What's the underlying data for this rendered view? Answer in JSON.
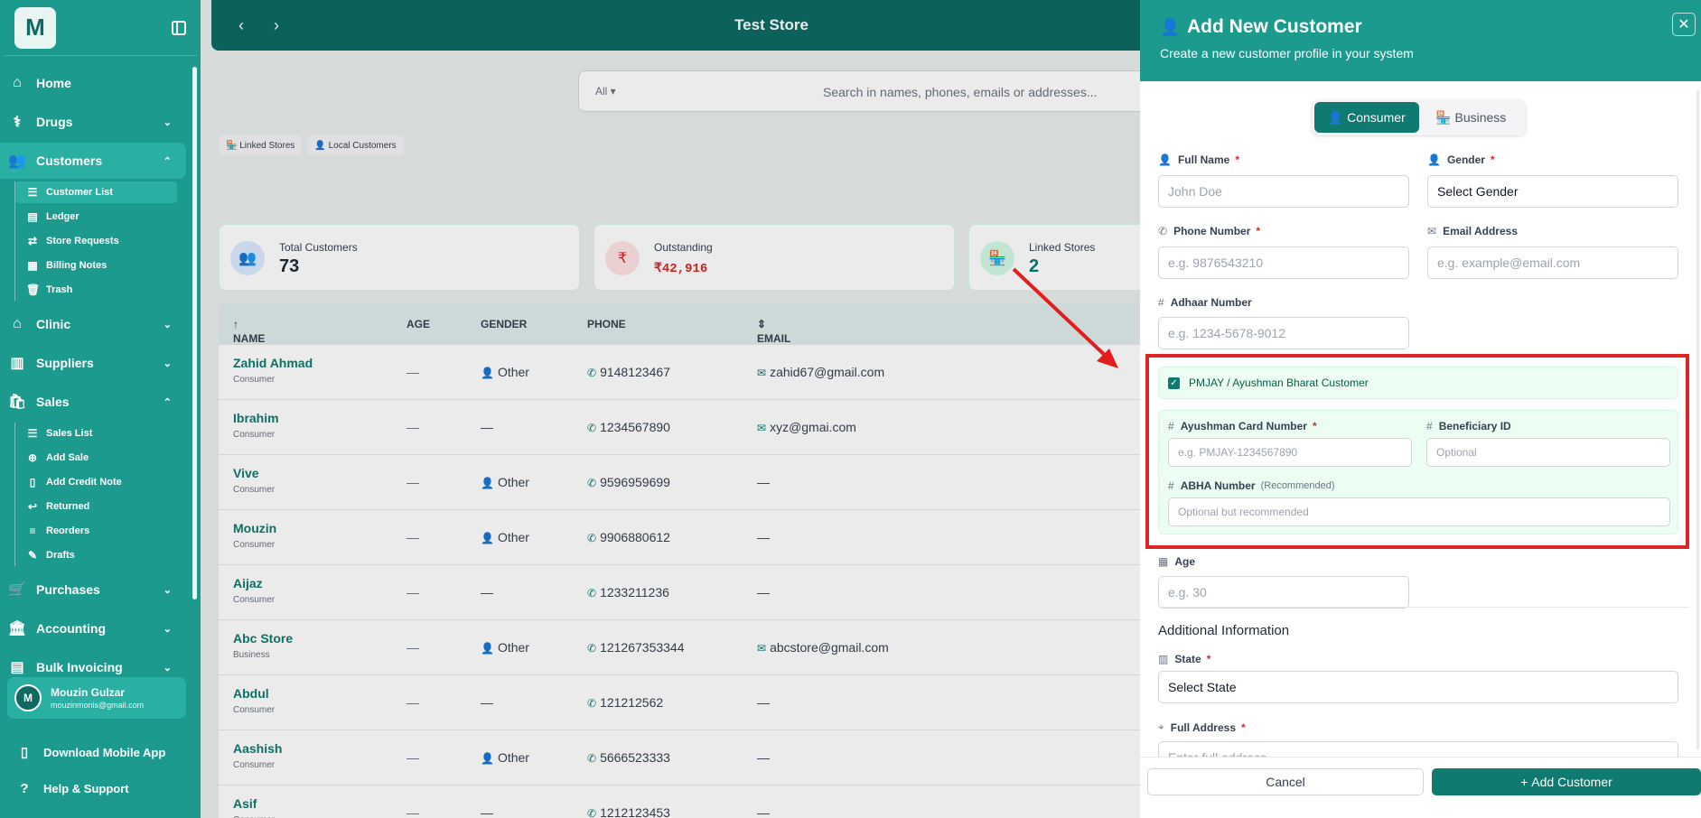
{
  "sidebar": {
    "logo": "M",
    "items": {
      "home": "Home",
      "drugs": "Drugs",
      "customers": "Customers",
      "clinic": "Clinic",
      "suppliers": "Suppliers",
      "sales": "Sales",
      "purchases": "Purchases",
      "accounting": "Accounting",
      "bulk": "Bulk Invoicing"
    },
    "customers_sub": [
      "Customer List",
      "Ledger",
      "Store Requests",
      "Billing Notes",
      "Trash"
    ],
    "sales_sub": [
      "Sales List",
      "Add Sale",
      "Add Credit Note",
      "Returned",
      "Reorders",
      "Drafts"
    ],
    "user": {
      "initial": "M",
      "name": "Mouzin Gulzar",
      "email": "mouzinmonis@gmail.com"
    },
    "download": "Download Mobile App",
    "help": "Help & Support"
  },
  "main": {
    "store_title": "Test Store",
    "search": {
      "filter": "All",
      "placeholder": "Search in names, phones, emails or addresses..."
    },
    "chips": [
      "Linked Stores",
      "Local Customers"
    ],
    "stats": [
      {
        "label": "Total Customers",
        "value": "73"
      },
      {
        "label": "Outstanding",
        "value": "₹42,916"
      },
      {
        "label": "Linked Stores",
        "value": "2"
      }
    ],
    "table": {
      "headers": {
        "name": "NAME",
        "age": "AGE",
        "gender": "GENDER",
        "phone": "PHONE",
        "email": "EMAIL"
      },
      "rows": [
        {
          "name": "Zahid Ahmad",
          "type": "Consumer",
          "age": "—",
          "gender": "Other",
          "phone": "9148123467",
          "email": "zahid67@gmail.com"
        },
        {
          "name": "Ibrahim",
          "type": "Consumer",
          "age": "—",
          "gender": "—",
          "phone": "1234567890",
          "email": "xyz@gmai.com"
        },
        {
          "name": "Vive",
          "type": "Consumer",
          "age": "—",
          "gender": "Other",
          "phone": "9596959699",
          "email": "—"
        },
        {
          "name": "Mouzin",
          "type": "Consumer",
          "age": "—",
          "gender": "Other",
          "phone": "9906880612",
          "email": "—"
        },
        {
          "name": "Aijaz",
          "type": "Consumer",
          "age": "—",
          "gender": "—",
          "phone": "1233211236",
          "email": "—"
        },
        {
          "name": "Abc Store",
          "type": "Business",
          "age": "—",
          "gender": "Other",
          "phone": "121267353344",
          "email": "abcstore@gmail.com"
        },
        {
          "name": "Abdul",
          "type": "Consumer",
          "age": "—",
          "gender": "—",
          "phone": "121212562",
          "email": "—"
        },
        {
          "name": "Aashish",
          "type": "Consumer",
          "age": "—",
          "gender": "Other",
          "phone": "5666523333",
          "email": "—"
        },
        {
          "name": "Asif",
          "type": "Consumer",
          "age": "—",
          "gender": "—",
          "phone": "1212123453",
          "email": "—"
        }
      ]
    }
  },
  "modal": {
    "title": "Add New Customer",
    "subtitle": "Create a new customer profile in your system",
    "tabs": {
      "consumer": "Consumer",
      "business": "Business"
    },
    "fields": {
      "full_name": {
        "label": "Full Name",
        "placeholder": "John Doe"
      },
      "gender": {
        "label": "Gender",
        "value": "Select Gender"
      },
      "phone": {
        "label": "Phone Number",
        "placeholder": "e.g. 9876543210"
      },
      "email": {
        "label": "Email Address",
        "placeholder": "e.g. example@email.com"
      },
      "adhaar": {
        "label": "Adhaar Number",
        "placeholder": "e.g. 1234-5678-9012"
      },
      "pmjay": {
        "label": "PMJAY / Ayushman Bharat Customer",
        "checked": true
      },
      "ayushman": {
        "label": "Ayushman Card Number",
        "placeholder": "e.g. PMJAY-1234567890"
      },
      "beneficiary": {
        "label": "Beneficiary ID",
        "placeholder": "Optional"
      },
      "abha": {
        "label": "ABHA Number",
        "note": "(Recommended)",
        "placeholder": "Optional but recommended"
      },
      "age": {
        "label": "Age",
        "placeholder": "e.g. 30"
      },
      "state": {
        "label": "State",
        "value": "Select State"
      },
      "address": {
        "label": "Full Address",
        "placeholder": "Enter full address"
      }
    },
    "section_additional": "Additional Information",
    "cancel": "Cancel",
    "submit": "Add Customer"
  },
  "colors": {
    "brand": "#1d9a8e",
    "brand_dark": "#0f7a70",
    "highlight": "#dc2626"
  }
}
